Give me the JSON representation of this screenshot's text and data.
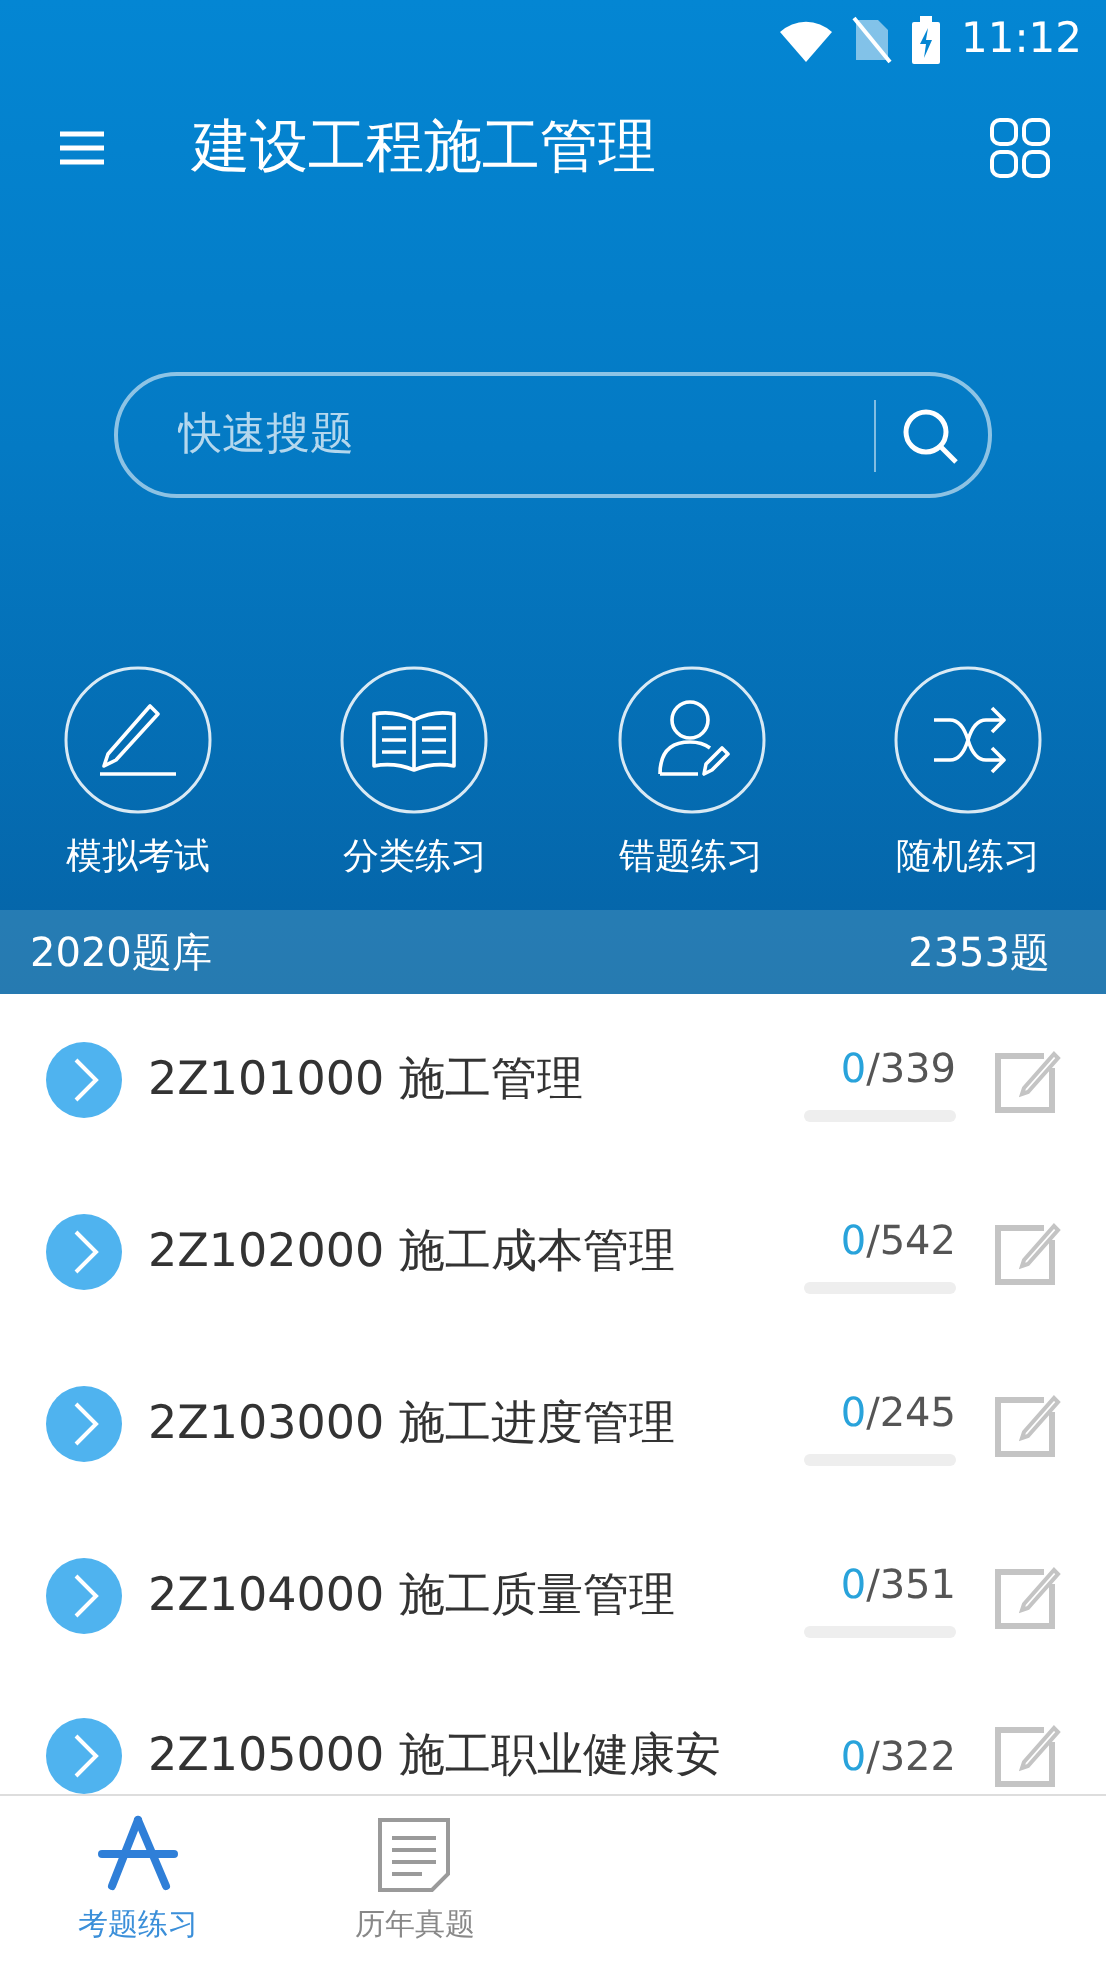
{
  "status_bar": {
    "time": "11:12"
  },
  "toolbar": {
    "title": "建设工程施工管理"
  },
  "search": {
    "placeholder": "快速搜题"
  },
  "quick_actions": [
    {
      "kind": "exam",
      "label": "模拟考试"
    },
    {
      "kind": "category",
      "label": "分类练习"
    },
    {
      "kind": "mistakes",
      "label": "错题练习"
    },
    {
      "kind": "random",
      "label": "随机练习"
    }
  ],
  "bank": {
    "title": "2020题库",
    "count": "2353题"
  },
  "chapters": [
    {
      "title": "2Z101000 施工管理",
      "done": "0",
      "total": "/339",
      "level": 0
    },
    {
      "title": "2Z102000 施工成本管理",
      "done": "0",
      "total": "/542",
      "level": 0
    },
    {
      "title": "2Z103000 施工进度管理",
      "done": "0",
      "total": "/245",
      "level": 0
    },
    {
      "title": "2Z104000 施工质量管理",
      "done": "0",
      "total": "/351",
      "level": 0
    },
    {
      "title": "2Z105000 施工职业健康安",
      "done": "0",
      "total": "/322"
    }
  ],
  "bottom_nav": [
    {
      "kind": "practice",
      "label": "考题练习",
      "selected": true
    },
    {
      "kind": "papers",
      "label": "历年真题",
      "selected": false
    }
  ]
}
